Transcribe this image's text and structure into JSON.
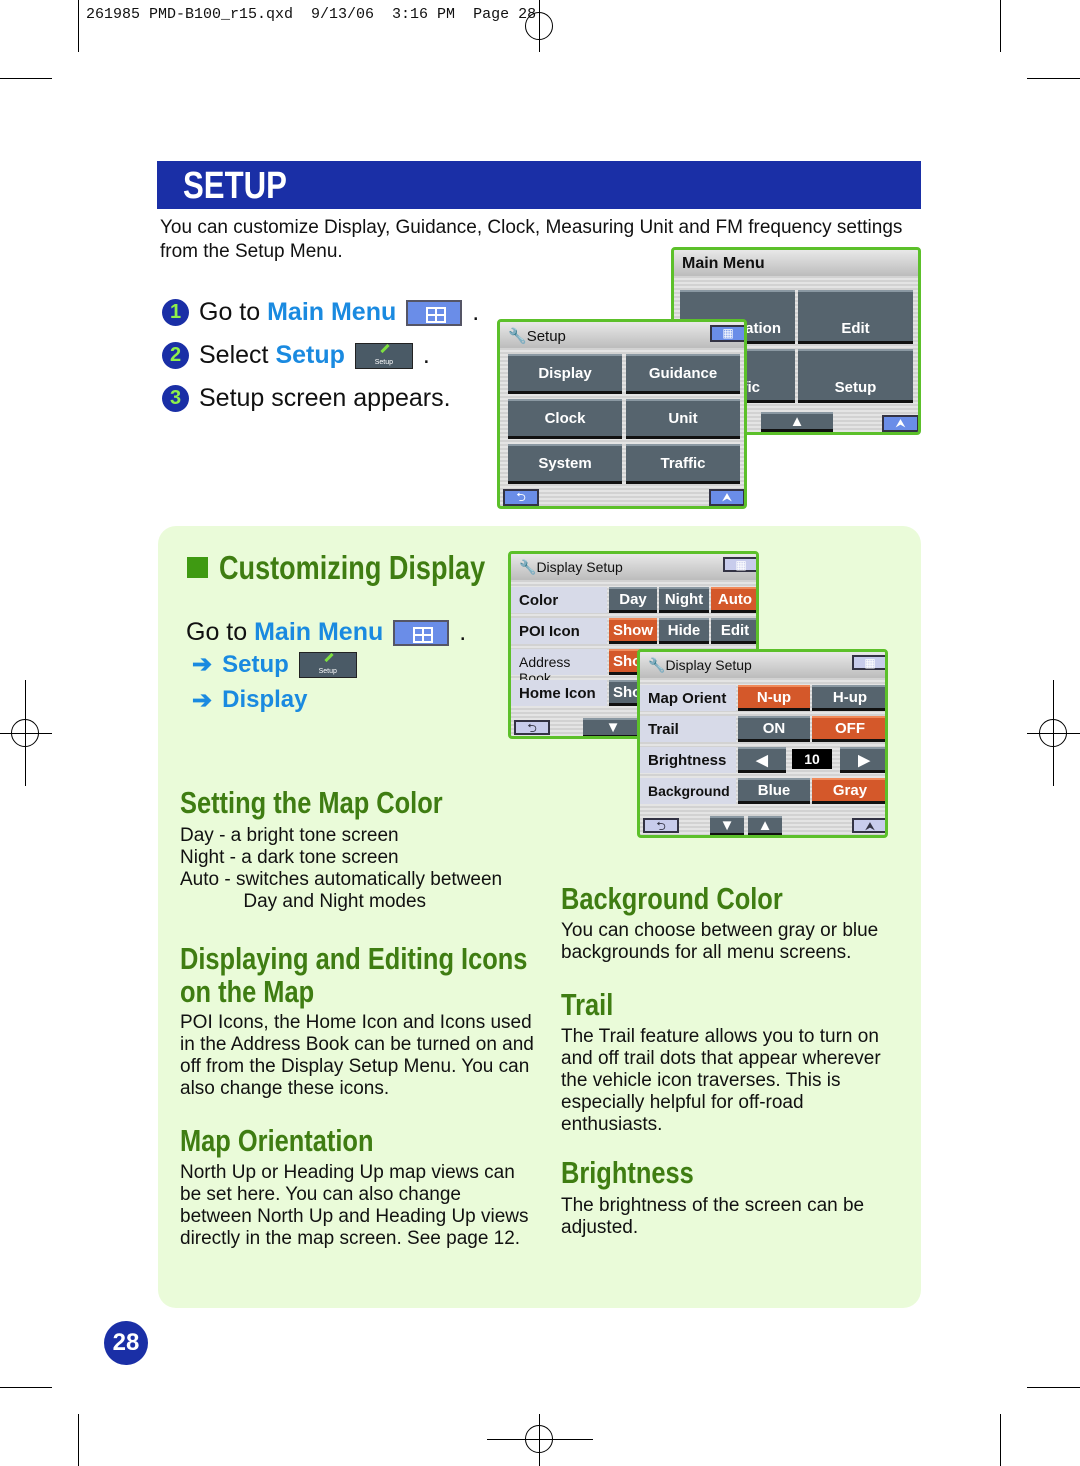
{
  "slug": "261985 PMD-B100_r15.qxd  9/13/06  3:16 PM  Page 28",
  "title": "SETUP",
  "intro": "You can customize Display, Guidance, Clock, Measuring Unit and FM frequency settings from the Setup Menu.",
  "steps": [
    {
      "n": "1",
      "pre": "Go to ",
      "link": "Main Menu",
      "post": "."
    },
    {
      "n": "2",
      "pre": "Select ",
      "link": "Setup",
      "post": "."
    },
    {
      "n": "3",
      "pre": "Setup screen appears.",
      "link": "",
      "post": ""
    }
  ],
  "setup_btn_label": "Setup",
  "main_menu": {
    "title": "Main Menu",
    "buttons": [
      "Information",
      "Edit",
      "Traffic",
      "Setup"
    ]
  },
  "setup_screen": {
    "title": "Setup",
    "buttons": [
      "Display",
      "Guidance",
      "Clock",
      "Unit",
      "System",
      "Traffic"
    ]
  },
  "section": {
    "title": "Customizing Display",
    "go_to": "Go to ",
    "main_menu": "Main Menu",
    "arrow": "➔",
    "setup": "Setup",
    "display": "Display"
  },
  "display_setup_1": {
    "title": "Display Setup",
    "rows": [
      {
        "label": "Color",
        "options": [
          "Day",
          "Night",
          "Auto"
        ],
        "selected": "Auto"
      },
      {
        "label": "POI Icon",
        "options": [
          "Show",
          "Hide",
          "Edit"
        ],
        "selected": "Show"
      },
      {
        "label": "Address Book",
        "options": [
          "Show"
        ],
        "selected": "Show"
      },
      {
        "label": "Home Icon",
        "options": [
          "Show"
        ],
        "selected": ""
      }
    ]
  },
  "display_setup_2": {
    "title": "Display Setup",
    "rows": [
      {
        "label": "Map Orient",
        "options": [
          "N-up",
          "H-up"
        ],
        "selected": "N-up"
      },
      {
        "label": "Trail",
        "options": [
          "ON",
          "OFF"
        ],
        "selected": "OFF"
      },
      {
        "label": "Brightness",
        "value": "10"
      },
      {
        "label": "Background",
        "options": [
          "Blue",
          "Gray"
        ],
        "selected": "Gray"
      }
    ]
  },
  "topics": [
    {
      "h": "Setting the Map Color",
      "t": "Day - a bright tone screen\nNight - a dark tone screen\nAuto - switches automatically between\n            Day and Night modes"
    },
    {
      "h": "Displaying and Editing Icons\non the Map",
      "t": "POI Icons, the Home Icon and Icons used in the Address Book can be turned on and off from the Display Setup Menu. You can also change these icons."
    },
    {
      "h": "Map Orientation",
      "t": "North Up or Heading Up map views can be set here.  You can also change between North Up and Heading Up views directly in the map screen.  See page 12."
    },
    {
      "h": "Background Color",
      "t": "You can choose between gray or blue backgrounds for all menu screens."
    },
    {
      "h": "Trail",
      "t": "The Trail feature allows you to turn on and off trail dots that appear wherever the vehicle icon traverses.  This is especially helpful for off-road enthusiasts."
    },
    {
      "h": "Brightness",
      "t": "The brightness of the screen can be adjusted."
    }
  ],
  "page_number": "28",
  "colors": {
    "header": "#1a2fa6",
    "panel": "#eafbd9",
    "heading": "#3f7d12",
    "link": "#1a8ae0",
    "selected": "#d4582a",
    "frame": "#5cc02a"
  }
}
